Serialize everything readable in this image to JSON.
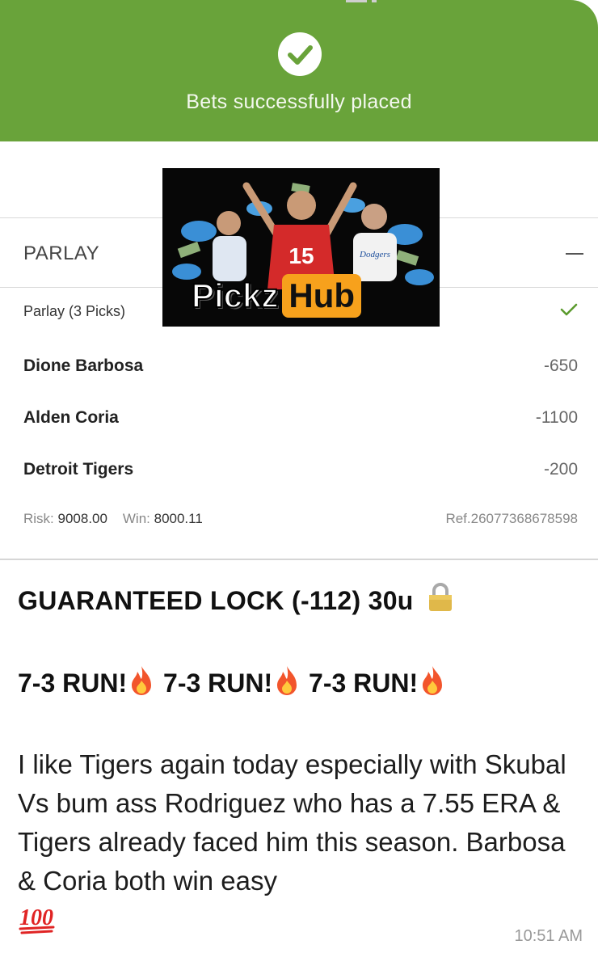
{
  "banner": {
    "message": "Bets successfully placed",
    "color": "#69a33a",
    "icon": "check-circle-icon"
  },
  "logo": {
    "word_left": "Pickz",
    "word_right": "Hub",
    "jersey_number": "15",
    "jersey_team": "Dodgers",
    "accent": "#f7a11c"
  },
  "bet": {
    "section_title": "PARLAY",
    "collapse_icon": "minus-icon",
    "picks_label": "Parlay (3 Picks)",
    "status_icon": "check-icon",
    "picks": [
      {
        "name": "Dione Barbosa",
        "odds": "-650"
      },
      {
        "name": "Alden Coria",
        "odds": "-1100"
      },
      {
        "name": "Detroit Tigers",
        "odds": "-200"
      }
    ],
    "risk_label": "Risk:",
    "risk_value": "9008.00",
    "win_label": "Win:",
    "win_value": "8000.11",
    "ref": "Ref.26077368678598"
  },
  "message": {
    "title": "GUARANTEED LOCK (-112) 30u",
    "title_icon": "lock-icon",
    "run_text": "7-3 RUN!",
    "run_icon": "fire-icon",
    "body": "I like Tigers again today especially with Skubal Vs bum ass Rodriguez who has a 7.55 ERA & Tigers already faced him this season. Barbosa & Coria both win easy",
    "end_icon": "hundred-points-icon",
    "timestamp": "10:51 AM"
  }
}
